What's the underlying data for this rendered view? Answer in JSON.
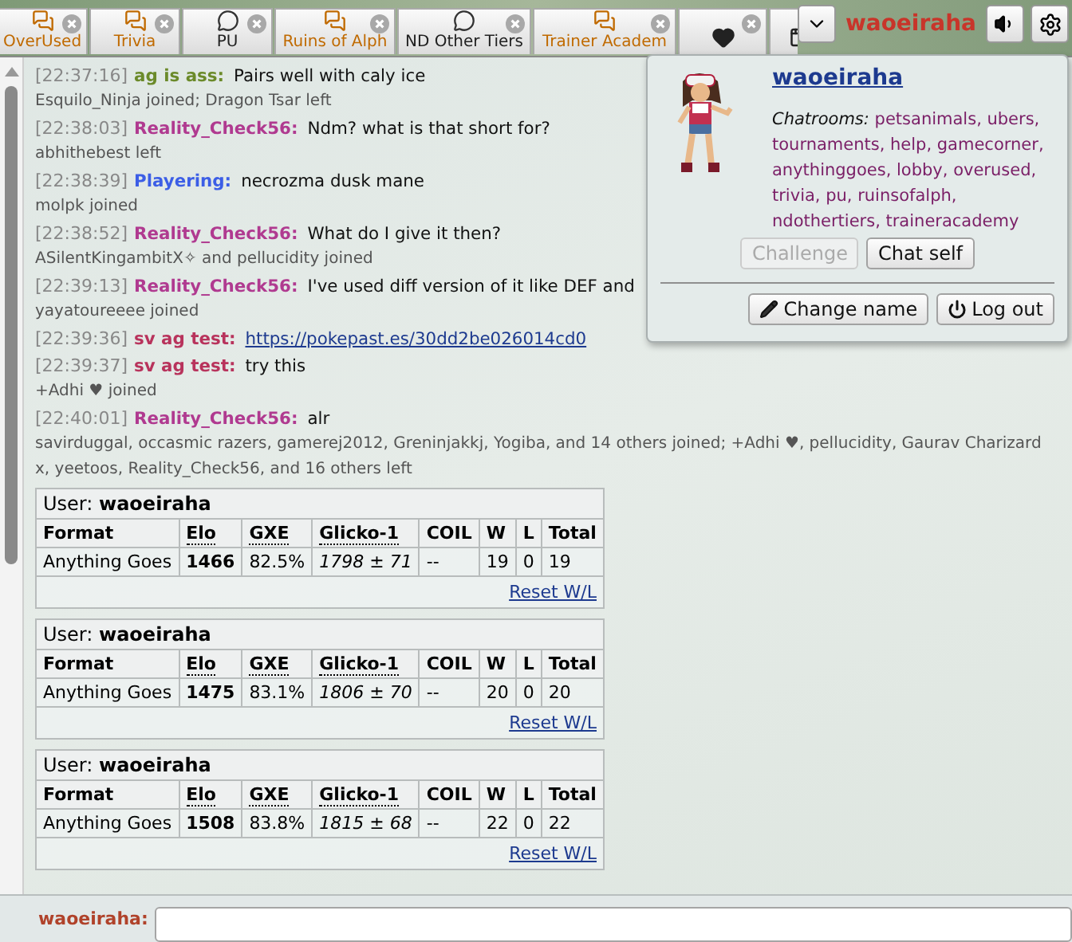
{
  "tabs": [
    {
      "kind": "room",
      "label": "OverUsed",
      "unread": true
    },
    {
      "kind": "room",
      "label": "Trivia",
      "unread": true
    },
    {
      "kind": "room",
      "label": "PU",
      "unread": false
    },
    {
      "kind": "room",
      "label": "Ruins of Alph",
      "unread": true
    },
    {
      "kind": "room",
      "label": "ND Other Tiers",
      "unread": false
    },
    {
      "kind": "room",
      "label": "Trainer Academ",
      "unread": true
    },
    {
      "kind": "heart"
    },
    {
      "kind": "window"
    }
  ],
  "user_bar": {
    "name": "waoeiraha"
  },
  "chat_log": [
    {
      "kind": "message",
      "time": "[22:37:16]",
      "name": "ag is ass:",
      "color": "#6b8a2a",
      "text": "Pairs well with caly ice"
    },
    {
      "kind": "notice",
      "text": "Esquilo_Ninja joined; Dragon Tsar left"
    },
    {
      "kind": "message",
      "time": "[22:38:03]",
      "name": "Reality_Check56:",
      "color": "#b03a90",
      "text": "Ndm? what is that short for?"
    },
    {
      "kind": "notice",
      "text": "abhithebest left"
    },
    {
      "kind": "message",
      "time": "[22:38:39]",
      "name": "Playering:",
      "color": "#3c5ee6",
      "text": "necrozma dusk mane"
    },
    {
      "kind": "notice",
      "text": "molpk joined"
    },
    {
      "kind": "message",
      "time": "[22:38:52]",
      "name": "Reality_Check56:",
      "color": "#b03a90",
      "text": "What do I give it then?"
    },
    {
      "kind": "notice",
      "text": "ASilentKingambitX✧ and pellucidity joined"
    },
    {
      "kind": "message",
      "time": "[22:39:13]",
      "name": "Reality_Check56:",
      "color": "#b03a90",
      "text": "I've used diff version of it like DEF and"
    },
    {
      "kind": "notice",
      "text": "yayatoureeee joined"
    },
    {
      "kind": "link",
      "time": "[22:39:36]",
      "name": "sv ag test:",
      "color": "#b8335c",
      "text": "https://pokepast.es/30dd2be026014cd0"
    },
    {
      "kind": "message",
      "time": "[22:39:37]",
      "name": "sv ag test:",
      "color": "#b8335c",
      "text": "try this"
    },
    {
      "kind": "notice",
      "text": "+Adhi ♥ joined"
    },
    {
      "kind": "message",
      "time": "[22:40:01]",
      "name": "Reality_Check56:",
      "color": "#b03a90",
      "text": "alr"
    },
    {
      "kind": "notice",
      "text": "savirduggal, occasmic razers, gamerej2012, Greninjakkj, Yogiba, and 14 others joined; +Adhi ♥, pellucidity, Gaurav Charizard x, yeetoos, Reality_Check56, and 16 others left"
    }
  ],
  "rankings": [
    {
      "user": "User: **waoeiraha**",
      "columns": [
        "Format",
        "Elo",
        "GXE",
        "Glicko-1",
        "COIL",
        "W",
        "L",
        "Total"
      ],
      "row": [
        "Anything Goes",
        "1466",
        "82.5%",
        "1798 ± 71",
        "--",
        "19",
        "0",
        "19"
      ],
      "link": "Reset W/L"
    },
    {
      "user": "User: **waoeiraha**",
      "columns": [
        "Format",
        "Elo",
        "GXE",
        "Glicko-1",
        "COIL",
        "W",
        "L",
        "Total"
      ],
      "row": [
        "Anything Goes",
        "1475",
        "83.1%",
        "1806 ± 70",
        "--",
        "20",
        "0",
        "20"
      ],
      "link": "Reset W/L"
    },
    {
      "user": "User: **waoeiraha**",
      "columns": [
        "Format",
        "Elo",
        "GXE",
        "Glicko-1",
        "COIL",
        "W",
        "L",
        "Total"
      ],
      "row": [
        "Anything Goes",
        "1508",
        "83.8%",
        "1815 ± 68",
        "--",
        "22",
        "0",
        "22"
      ],
      "link": "Reset W/L"
    }
  ],
  "composer": {
    "label": "waoeiraha:"
  },
  "popup": {
    "name": "waoeiraha",
    "chatrooms_label": "Chatrooms:",
    "rooms": "petsanimals, ubers, tournaments, help, gamecorner, anythinggoes, lobby, overused, trivia, pu, ruinsofalph, ndothertiers, traineracademy",
    "buttons": [
      {
        "label": "Challenge",
        "disabled": true
      },
      {
        "label": "Chat self",
        "disabled": false
      }
    ],
    "actions": [
      {
        "kind": "pencil",
        "label": "Change name"
      },
      {
        "kind": "power",
        "label": "Log out"
      }
    ]
  }
}
